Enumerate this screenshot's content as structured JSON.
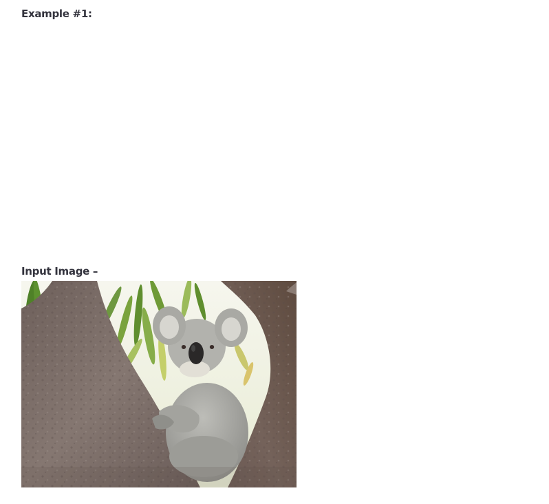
{
  "example_heading": "Example #1:",
  "input_image_label": "Input Image –",
  "image": {
    "subject": "koala-in-tree",
    "colors": {
      "sky": "#f2f4e4",
      "leaf": "#5f8e2e",
      "bark": "#7a6d69",
      "fur": "#a6a6a2",
      "nose": "#2a2828"
    }
  }
}
